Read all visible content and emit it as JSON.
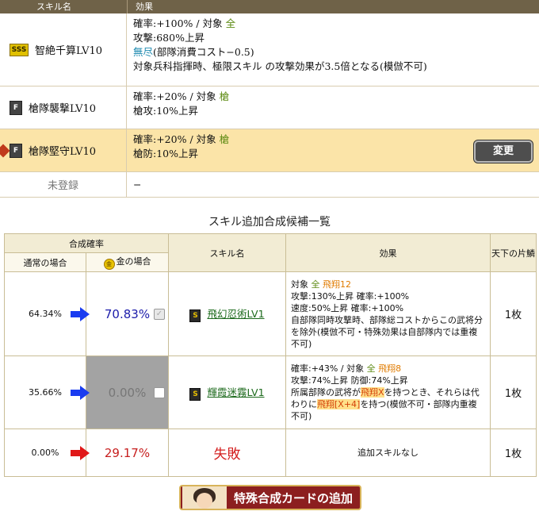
{
  "skill_table": {
    "header_name": "スキル名",
    "header_effect": "効果",
    "rows": [
      {
        "badge": "SSS",
        "name": "智絶千算LV10",
        "lines": [
          {
            "prefix": "確率:+100%  /  対象  ",
            "hl": "全",
            "suffix": ""
          },
          {
            "prefix": "攻撃:680%上昇",
            "hl": "",
            "suffix": ""
          },
          {
            "prefix": "",
            "teal": "無尽",
            "suffix": "(部隊消費コスト−0.5)"
          },
          {
            "prefix": "対象兵科指揮時、極限スキル の攻撃効果が3.5倍となる(模倣不可)",
            "hl": "",
            "suffix": ""
          }
        ]
      },
      {
        "badge": "F",
        "name": "槍隊襲撃LV10",
        "lines": [
          {
            "prefix": "確率:+20%  /  対象  ",
            "hl": "槍",
            "suffix": ""
          },
          {
            "prefix": "槍攻:10%上昇",
            "hl": "",
            "suffix": ""
          }
        ]
      },
      {
        "badge": "F",
        "name": "槍隊堅守LV10",
        "lines": [
          {
            "prefix": "確率:+20%  /  対象  ",
            "hl": "槍",
            "suffix": ""
          },
          {
            "prefix": "槍防:10%上昇",
            "hl": "",
            "suffix": ""
          }
        ],
        "button": "変更"
      },
      {
        "name": "未登録",
        "lines": [
          {
            "prefix": "−"
          }
        ]
      }
    ]
  },
  "section_title": "スキル追加合成候補一覧",
  "candidate_table": {
    "h_rate": "合成確率",
    "h_normal": "通常の場合",
    "h_gold": "金の場合",
    "h_gold_coin": "金",
    "h_skill": "スキル名",
    "h_effect": "効果",
    "h_count": "天下の片鱗",
    "rows": [
      {
        "normal": "64.34%",
        "gold": "70.83%",
        "badge": "S",
        "skill": "飛幻忍術LV1",
        "effect": [
          "対象  <g>全</g>  <o>飛翔12</o>",
          "攻撃:130%上昇  確率:+100%",
          "速度:50%上昇  確率:+100%",
          "自部隊同時攻撃時、部隊総コストからこの武将分を除外(模倣不可・特殊効果は自部隊内では重複不可)"
        ],
        "count": "1枚"
      },
      {
        "normal": "35.66%",
        "gold": "0.00%",
        "badge": "S",
        "skill": "輝霞迷霧LV1",
        "effect": [
          "確率:+43%  /  対象  <g>全</g>  <o>飛翔8</o>",
          "攻撃:74%上昇  防御:74%上昇",
          "所属部隊の武将が<h>飛翔X</h>を持つとき、それらは代わりに<h>飛翔[X+4]</h>を持つ(模倣不可・部隊内重複不可)"
        ],
        "count": "1枚"
      },
      {
        "normal": "0.00%",
        "gold": "29.17%",
        "skill": "失敗",
        "effect_text": "追加スキルなし",
        "count": "1枚"
      }
    ]
  },
  "special_button": "特殊合成カードの追加",
  "colors": {
    "blue_arrow": "#1a3cf0",
    "red_arrow": "#e01818",
    "header_bg": "#6f6248"
  }
}
